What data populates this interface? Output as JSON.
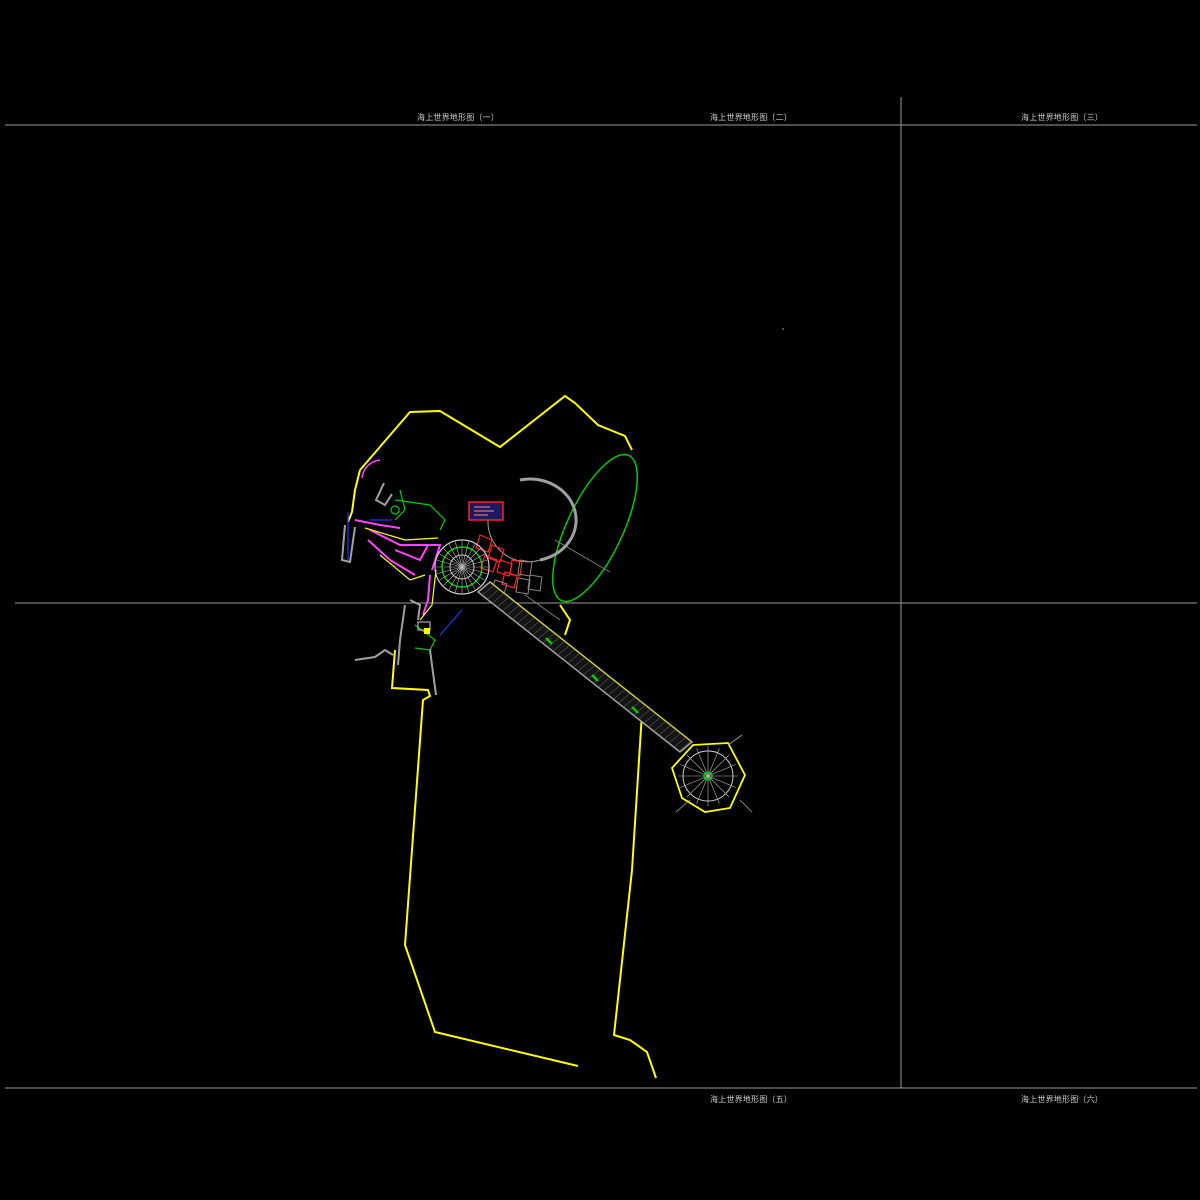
{
  "sheet_labels": {
    "s1": "海上世界地形图（一）",
    "s2": "海上世界地形图（二）",
    "s3": "海上世界地形图（三）",
    "s5": "海上世界地形图（五）",
    "s6": "海上世界地形图（六）"
  },
  "colors": {
    "background": "#000000",
    "grid_line": "#9a9a9a",
    "boundary": "#ffff00",
    "road": "#a0a0a0",
    "green": "#00cc00",
    "magenta": "#ff44ff",
    "red": "#ff2020",
    "blue": "#2233ff",
    "white": "#ffffff"
  }
}
